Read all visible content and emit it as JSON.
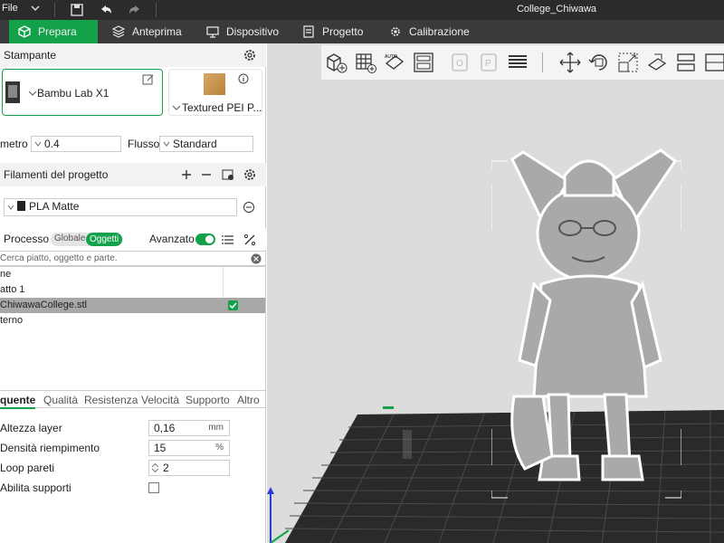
{
  "titlebar": {
    "file_menu": "File",
    "document_title": "College_Chiwawa"
  },
  "tabs": [
    {
      "label": "Prepara",
      "icon": "cube-icon",
      "active": true
    },
    {
      "label": "Anteprima",
      "icon": "layers-icon",
      "active": false
    },
    {
      "label": "Dispositivo",
      "icon": "monitor-icon",
      "active": false
    },
    {
      "label": "Progetto",
      "icon": "document-icon",
      "active": false
    },
    {
      "label": "Calibrazione",
      "icon": "gear-icon",
      "active": false
    }
  ],
  "printer_section": {
    "title": "Stampante",
    "printer_name": "Bambu Lab X1",
    "plate_name": "Textured PEI P..."
  },
  "nozzle": {
    "label": "metro",
    "value": "0.4",
    "flow_label": "Flusso",
    "flow_value": "Standard"
  },
  "filaments": {
    "title": "Filamenti del progetto",
    "items": [
      "PLA Matte"
    ]
  },
  "process": {
    "title": "Processo",
    "segment": [
      "Globale",
      "Oggetti"
    ],
    "advanced_label": "Avanzato",
    "advanced_on": true
  },
  "search": {
    "placeholder": "Cerca piatto, oggetto e parte."
  },
  "tree": [
    {
      "label": "ne",
      "selected": false
    },
    {
      "label": "atto 1",
      "selected": false
    },
    {
      "label": "ChiwawaCollege.stl",
      "selected": true,
      "checked": true
    },
    {
      "label": "terno",
      "selected": false
    }
  ],
  "settings_tabs": [
    "quente",
    "Qualità",
    "Resistenza",
    "Velocità",
    "Supporto",
    "Altro"
  ],
  "settings": {
    "layer_height": {
      "label": "Altezza layer",
      "value": "0,16",
      "unit": "mm"
    },
    "infill": {
      "label": "Densità riempimento",
      "value": "15",
      "unit": "%"
    },
    "walls": {
      "label": "Loop pareti",
      "value": "2"
    },
    "supports": {
      "label": "Abilita supporti",
      "checked": false
    }
  },
  "colors": {
    "accent": "#13a14a",
    "titlebar": "#2b2b2b",
    "tabbar": "#3a3a3a",
    "viewport_bg": "#dcdcdc",
    "bed": "#2a2a2a"
  }
}
